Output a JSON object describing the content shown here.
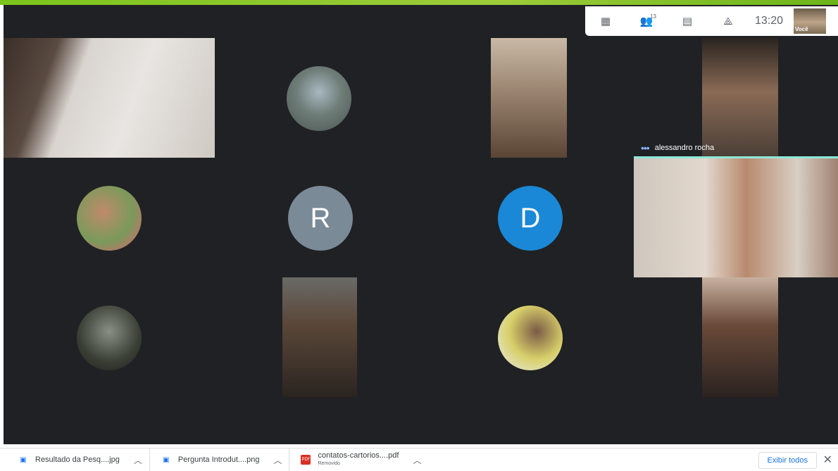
{
  "toolbar": {
    "participants_count": "13",
    "clock": "13:20",
    "self_label": "Você"
  },
  "tiles": {
    "r2c2_letter": "R",
    "r2c3_letter": "D",
    "r1c4_name": "alessandro rocha"
  },
  "colors": {
    "r_avatar": "#7b8a97",
    "d_avatar": "#1a88d6",
    "meet_bg": "#202124",
    "active_speaker": "#8ee8d8"
  },
  "downloads": [
    {
      "name": "Resultado da Pesq....jpg",
      "icon": "image-file-icon"
    },
    {
      "name": "Pergunta Introdut....png",
      "icon": "image-file-icon"
    },
    {
      "name": "contatos-cartorios....pdf",
      "sub": "Removido",
      "icon": "pdf-file-icon"
    }
  ],
  "download_bar": {
    "show_all": "Exibir todos"
  }
}
